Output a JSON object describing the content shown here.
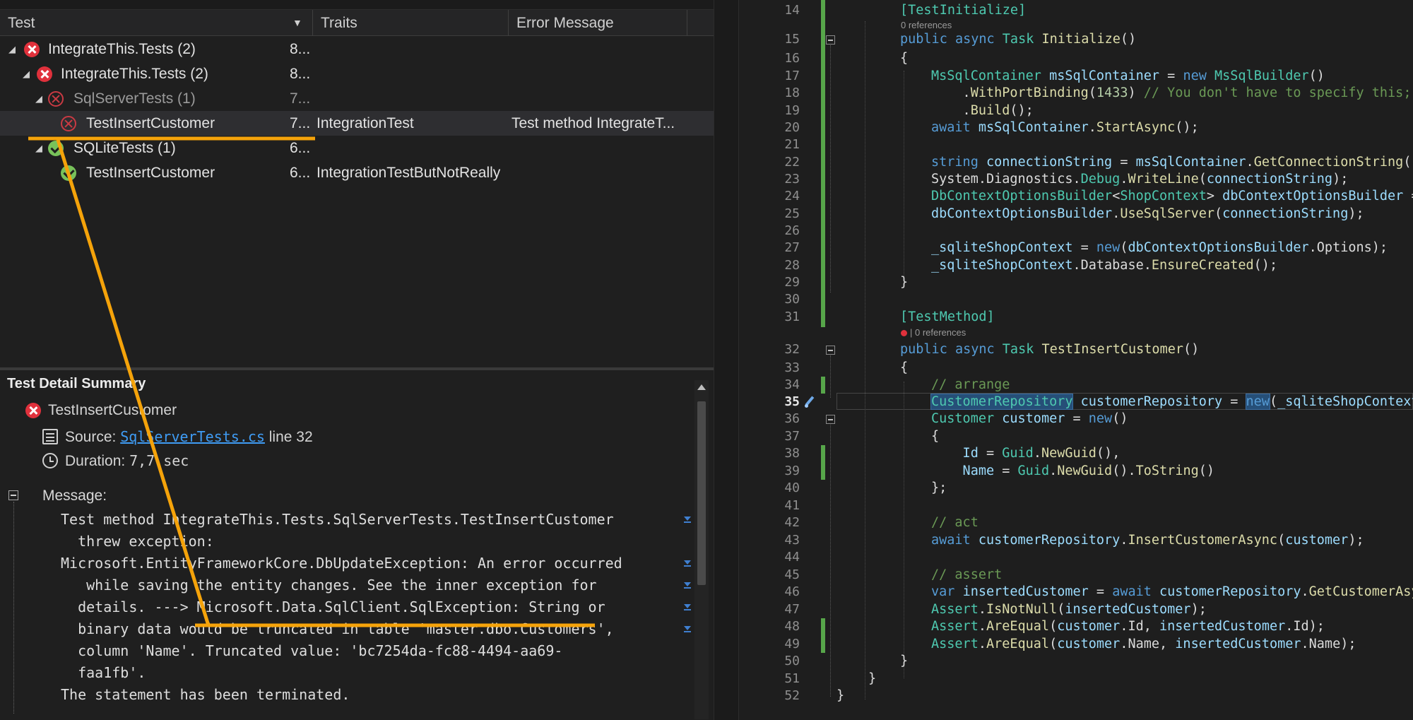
{
  "test_explorer": {
    "columns": {
      "test": "Test",
      "traits": "Traits",
      "error": "Error Message"
    },
    "rows": [
      {
        "name": "IntegrateThis.Tests (2)",
        "duration": "8...",
        "traits": "",
        "error": "",
        "state": "fail",
        "level": 0
      },
      {
        "name": "IntegrateThis.Tests (2)",
        "duration": "8...",
        "traits": "",
        "error": "",
        "state": "fail",
        "level": 1
      },
      {
        "name": "SqlServerTests (1)",
        "duration": "7...",
        "traits": "",
        "error": "",
        "state": "fail-outline",
        "level": 2
      },
      {
        "name": "TestInsertCustomer",
        "duration": "7...",
        "traits": "IntegrationTest",
        "error": "Test method IntegrateT...",
        "state": "fail-outline",
        "level": 3
      },
      {
        "name": "SQLiteTests (1)",
        "duration": "6...",
        "traits": "",
        "error": "",
        "state": "pass",
        "level": 2
      },
      {
        "name": "TestInsertCustomer",
        "duration": "6...",
        "traits": "IntegrationTestButNotReally",
        "error": "",
        "state": "pass",
        "level": 3
      }
    ]
  },
  "detail": {
    "title": "Test Detail Summary",
    "test_name": "TestInsertCustomer",
    "source_label": "Source:",
    "source_file": "SqlServerTests.cs",
    "source_line": "line 32",
    "duration_label": "Duration:",
    "duration_value": "7,7 sec",
    "message_label": "Message:",
    "message_lines": [
      "Test method IntegrateThis.Tests.SqlServerTests.TestInsertCustomer",
      "  threw exception:",
      "Microsoft.EntityFrameworkCore.DbUpdateException: An error occurred",
      "   while saving the entity changes. See the inner exception for",
      "  details. ---> Microsoft.Data.SqlClient.SqlException: String or",
      "  binary data would be truncated in table 'master.dbo.Customers',",
      "  column 'Name'. Truncated value: 'bc7254da-fc88-4494-aa69-",
      "  faa1fb'.",
      "The statement has been terminated."
    ]
  },
  "editor": {
    "line_numbers": [
      "14",
      "15",
      "16",
      "17",
      "18",
      "19",
      "20",
      "21",
      "22",
      "23",
      "24",
      "25",
      "26",
      "27",
      "28",
      "29",
      "30",
      "31",
      "32",
      "33",
      "34",
      "35",
      "36",
      "37",
      "38",
      "39",
      "40",
      "41",
      "42",
      "43",
      "44",
      "45",
      "46",
      "47",
      "48",
      "49",
      "50",
      "51",
      "52"
    ],
    "current_line": "35",
    "codelens_1": "0 references",
    "codelens_2": "| 0 references",
    "code": {
      "l14": "[TestInitialize]",
      "l15a": "public async ",
      "l15b": "Task ",
      "l15c": "Initialize",
      "l15d": "()",
      "l16": "{",
      "l17a": "MsSqlContainer ",
      "l17b": "msSqlContainer",
      "l17c": " = ",
      "l17d": "new ",
      "l17e": "MsSqlBuilder",
      "l17f": "()",
      "l18a": "    .",
      "l18b": "WithPortBinding",
      "l18c": "(",
      "l18d": "1433",
      "l18e": ") ",
      "l18f": "// You don't have to specify this;",
      "l19a": "    .",
      "l19b": "Build",
      "l19c": "();",
      "l20a": "await ",
      "l20b": "msSqlContainer",
      "l20c": ".",
      "l20d": "StartAsync",
      "l20e": "();",
      "l22a": "string ",
      "l22b": "connectionString",
      "l22c": " = ",
      "l22d": "msSqlContainer",
      "l22e": ".",
      "l22f": "GetConnectionString",
      "l22g": "();",
      "l23a": "System.Diagnostics.",
      "l23b": "Debug",
      "l23c": ".",
      "l23d": "WriteLine",
      "l23e": "(",
      "l23f": "connectionString",
      "l23g": ");",
      "l24a": "DbContextOptionsBuilder",
      "l24b": "<",
      "l24c": "ShopContext",
      "l24d": "> ",
      "l24e": "dbContextOptionsBuilder",
      "l24f": " =",
      "l25a": "dbContextOptionsBuilder",
      "l25b": ".",
      "l25c": "UseSqlServer",
      "l25d": "(",
      "l25e": "connectionString",
      "l25f": ");",
      "l27a": "_sqliteShopContext",
      "l27b": " = ",
      "l27c": "new",
      "l27d": "(",
      "l27e": "dbContextOptionsBuilder",
      "l27f": ".Options);",
      "l28a": "_sqliteShopContext",
      "l28b": ".Database.",
      "l28c": "EnsureCreated",
      "l28d": "();",
      "l29": "}",
      "l31": "[TestMethod]",
      "l32a": "public async ",
      "l32b": "Task ",
      "l32c": "TestInsertCustomer",
      "l32d": "()",
      "l33": "{",
      "l34": "// arrange",
      "l35a": "CustomerRepository",
      "l35b": " ",
      "l35c": "customerRepository",
      "l35d": " = ",
      "l35e": "new",
      "l35f": "(",
      "l35g": "_sqliteShopContext",
      "l36a": "Customer ",
      "l36b": "customer",
      "l36c": " = ",
      "l36d": "new",
      "l36e": "()",
      "l37": "{",
      "l38a": "    Id",
      "l38b": " = ",
      "l38c": "Guid",
      "l38d": ".",
      "l38e": "NewGuid",
      "l38f": "(),",
      "l39a": "    Name",
      "l39b": " = ",
      "l39c": "Guid",
      "l39d": ".",
      "l39e": "NewGuid",
      "l39f": "().",
      "l39g": "ToString",
      "l39h": "()",
      "l40": "};",
      "l42": "// act",
      "l43a": "await ",
      "l43b": "customerRepository",
      "l43c": ".",
      "l43d": "InsertCustomerAsync",
      "l43e": "(",
      "l43f": "customer",
      "l43g": ");",
      "l45": "// assert",
      "l46a": "var ",
      "l46b": "insertedCustomer",
      "l46c": " = ",
      "l46d": "await ",
      "l46e": "customerRepository",
      "l46f": ".",
      "l46g": "GetCustomerAsy",
      "l47a": "Assert",
      "l47b": ".",
      "l47c": "IsNotNull",
      "l47d": "(",
      "l47e": "insertedCustomer",
      "l47f": ");",
      "l48a": "Assert",
      "l48b": ".",
      "l48c": "AreEqual",
      "l48d": "(",
      "l48e": "customer",
      "l48f": ".Id, ",
      "l48g": "insertedCustomer",
      "l48h": ".Id);",
      "l49a": "Assert",
      "l49b": ".",
      "l49c": "AreEqual",
      "l49d": "(",
      "l49e": "customer",
      "l49f": ".Name, ",
      "l49g": "insertedCustomer",
      "l49h": ".Name);",
      "l50": "}",
      "l51": "}",
      "l52": "}"
    }
  },
  "colors": {
    "annotation": "#f5a30a",
    "fail": "#e0313c",
    "pass": "#78c25a",
    "keyword": "#569cd6",
    "type": "#4ec9b0"
  }
}
